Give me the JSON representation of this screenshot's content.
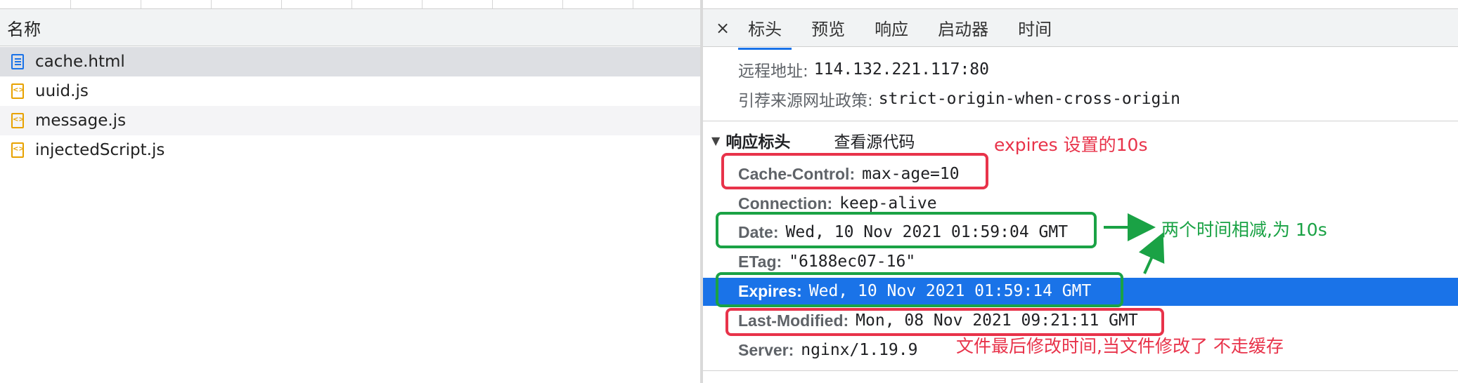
{
  "left_panel": {
    "column_header": "名称",
    "files": [
      {
        "name": "cache.html",
        "icon": "document-icon",
        "selected": true
      },
      {
        "name": "uuid.js",
        "icon": "script-icon",
        "selected": false
      },
      {
        "name": "message.js",
        "icon": "script-icon",
        "selected": false
      },
      {
        "name": "injectedScript.js",
        "icon": "script-icon",
        "selected": false
      }
    ]
  },
  "tabs": {
    "close": "×",
    "items": [
      "标头",
      "预览",
      "响应",
      "启动器",
      "时间"
    ],
    "active": "标头"
  },
  "general": {
    "remote_address_key": "远程地址:",
    "remote_address_value": "114.132.221.117:80",
    "referrer_policy_key": "引荐来源网址政策:",
    "referrer_policy_value": "strict-origin-when-cross-origin"
  },
  "response_headers": {
    "title": "响应标头",
    "view_source": "查看源代码",
    "items": [
      {
        "key": "Cache-Control:",
        "value": "max-age=10"
      },
      {
        "key": "Connection:",
        "value": "keep-alive"
      },
      {
        "key": "Date:",
        "value": "Wed, 10 Nov 2021 01:59:04 GMT"
      },
      {
        "key": "ETag:",
        "value": "\"6188ec07-16\""
      },
      {
        "key": "Expires:",
        "value": "Wed, 10 Nov 2021 01:59:14 GMT"
      },
      {
        "key": "Last-Modified:",
        "value": "Mon, 08 Nov 2021 09:21:11 GMT"
      },
      {
        "key": "Server:",
        "value": "nginx/1.19.9"
      }
    ]
  },
  "annotations": {
    "expires_note": "expires 设置的10s",
    "diff_note": "两个时间相减,为 10s",
    "last_modified_note": "文件最后修改时间,当文件修改了 不走缓存"
  },
  "colors": {
    "accent": "#1a73e8",
    "annotation_red": "#e8334a",
    "annotation_green": "#1aa245"
  }
}
